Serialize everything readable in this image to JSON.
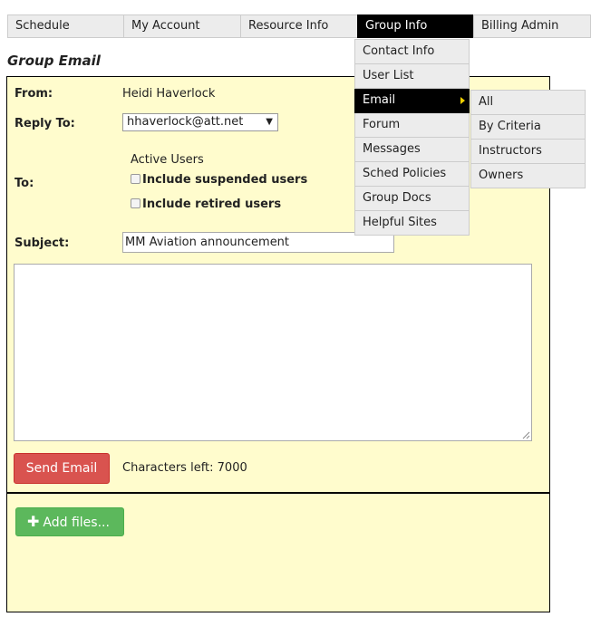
{
  "nav": {
    "items": [
      "Schedule",
      "My Account",
      "Resource Info",
      "Group Info",
      "Billing Admin"
    ],
    "active": "Group Info"
  },
  "page_title": "Group Email",
  "form": {
    "from_label": "From:",
    "from_value": "Heidi Haverlock",
    "reply_to_label": "Reply To:",
    "reply_to_value": "hhaverlock@att.net",
    "to_label": "To:",
    "active_users": "Active Users",
    "include_suspended": "Include suspended users",
    "include_retired": "Include retired users",
    "subject_label": "Subject:",
    "subject_value": "MM Aviation announcement",
    "body_value": "",
    "send_button": "Send Email",
    "chars_left": "Characters left: 7000"
  },
  "files": {
    "add_button": "Add files..."
  },
  "group_menu": {
    "items": [
      "Contact Info",
      "User List",
      "Email",
      "Forum",
      "Messages",
      "Sched Policies",
      "Group Docs",
      "Helpful Sites"
    ],
    "highlighted": "Email"
  },
  "email_menu": {
    "items": [
      "All",
      "By Criteria",
      "Instructors",
      "Owners"
    ]
  },
  "colors": {
    "form_bg": "#fffccd",
    "send_button": "#d9534f",
    "add_files_button": "#5cb85c",
    "menu_bg": "#ececec",
    "active": "#000000"
  }
}
